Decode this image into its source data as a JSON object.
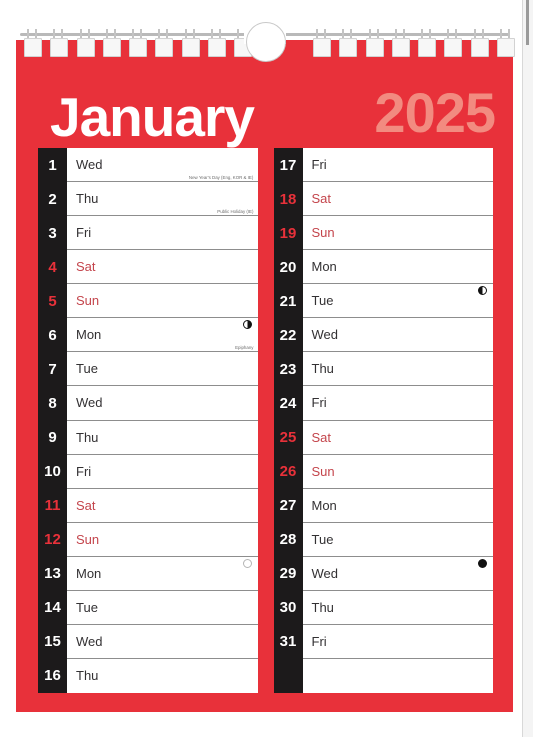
{
  "calendar": {
    "month": "January",
    "year": "2025",
    "colors": {
      "background_red": "#e8313a",
      "year_text": "#f28b80",
      "number_strip": "#1c1a1b",
      "weekend_red": "#e8313a",
      "paper_white": "#ffffff"
    },
    "left_column": [
      {
        "day": "1",
        "dow": "Wed",
        "weekend": false,
        "note": "New Year's Day (Eng, KOR & IE)",
        "moon": ""
      },
      {
        "day": "2",
        "dow": "Thu",
        "weekend": false,
        "note": "Public Holiday (IE)",
        "moon": ""
      },
      {
        "day": "3",
        "dow": "Fri",
        "weekend": false,
        "note": "",
        "moon": ""
      },
      {
        "day": "4",
        "dow": "Sat",
        "weekend": true,
        "note": "",
        "moon": ""
      },
      {
        "day": "5",
        "dow": "Sun",
        "weekend": true,
        "note": "",
        "moon": ""
      },
      {
        "day": "6",
        "dow": "Mon",
        "weekend": false,
        "note": "Epiphany",
        "moon": "first-quarter"
      },
      {
        "day": "7",
        "dow": "Tue",
        "weekend": false,
        "note": "",
        "moon": ""
      },
      {
        "day": "8",
        "dow": "Wed",
        "weekend": false,
        "note": "",
        "moon": ""
      },
      {
        "day": "9",
        "dow": "Thu",
        "weekend": false,
        "note": "",
        "moon": ""
      },
      {
        "day": "10",
        "dow": "Fri",
        "weekend": false,
        "note": "",
        "moon": ""
      },
      {
        "day": "11",
        "dow": "Sat",
        "weekend": true,
        "note": "",
        "moon": ""
      },
      {
        "day": "12",
        "dow": "Sun",
        "weekend": true,
        "note": "",
        "moon": ""
      },
      {
        "day": "13",
        "dow": "Mon",
        "weekend": false,
        "note": "",
        "moon": "full"
      },
      {
        "day": "14",
        "dow": "Tue",
        "weekend": false,
        "note": "",
        "moon": ""
      },
      {
        "day": "15",
        "dow": "Wed",
        "weekend": false,
        "note": "",
        "moon": ""
      },
      {
        "day": "16",
        "dow": "Thu",
        "weekend": false,
        "note": "",
        "moon": ""
      }
    ],
    "right_column": [
      {
        "day": "17",
        "dow": "Fri",
        "weekend": false,
        "note": "",
        "moon": ""
      },
      {
        "day": "18",
        "dow": "Sat",
        "weekend": true,
        "note": "",
        "moon": ""
      },
      {
        "day": "19",
        "dow": "Sun",
        "weekend": true,
        "note": "",
        "moon": ""
      },
      {
        "day": "20",
        "dow": "Mon",
        "weekend": false,
        "note": "",
        "moon": ""
      },
      {
        "day": "21",
        "dow": "Tue",
        "weekend": false,
        "note": "",
        "moon": "last-quarter"
      },
      {
        "day": "22",
        "dow": "Wed",
        "weekend": false,
        "note": "",
        "moon": ""
      },
      {
        "day": "23",
        "dow": "Thu",
        "weekend": false,
        "note": "",
        "moon": ""
      },
      {
        "day": "24",
        "dow": "Fri",
        "weekend": false,
        "note": "",
        "moon": ""
      },
      {
        "day": "25",
        "dow": "Sat",
        "weekend": true,
        "note": "",
        "moon": ""
      },
      {
        "day": "26",
        "dow": "Sun",
        "weekend": true,
        "note": "",
        "moon": ""
      },
      {
        "day": "27",
        "dow": "Mon",
        "weekend": false,
        "note": "",
        "moon": ""
      },
      {
        "day": "28",
        "dow": "Tue",
        "weekend": false,
        "note": "",
        "moon": ""
      },
      {
        "day": "29",
        "dow": "Wed",
        "weekend": false,
        "note": "",
        "moon": "new"
      },
      {
        "day": "30",
        "dow": "Thu",
        "weekend": false,
        "note": "",
        "moon": ""
      },
      {
        "day": "31",
        "dow": "Fri",
        "weekend": false,
        "note": "",
        "moon": ""
      },
      {
        "day": "",
        "dow": "",
        "weekend": false,
        "note": "",
        "moon": ""
      }
    ],
    "binding": {
      "coil_count": 19,
      "icon": "spiral-wire-binding",
      "hang_hole_icon": "hanging-hole"
    }
  }
}
